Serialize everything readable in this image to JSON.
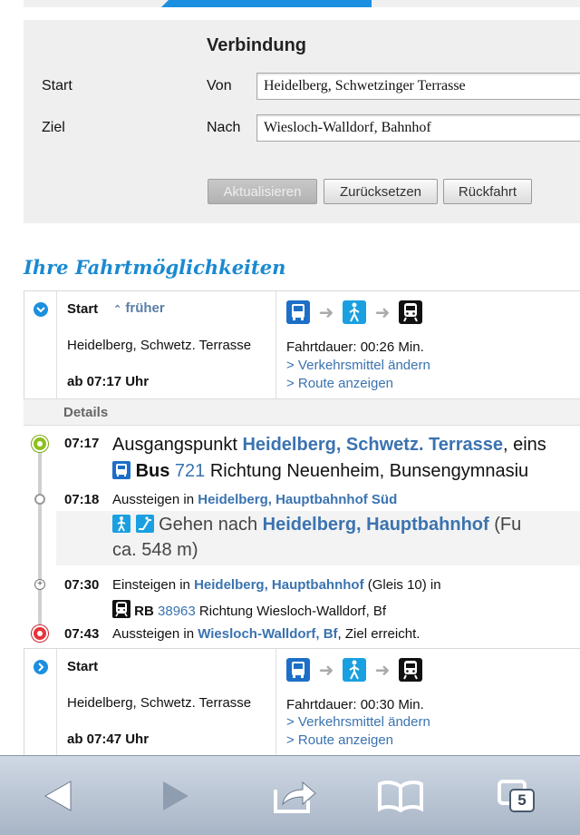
{
  "form": {
    "title": "Verbindung",
    "start_label": "Start",
    "ziel_label": "Ziel",
    "von_label": "Von",
    "nach_label": "Nach",
    "von_value": "Heidelberg, Schwetzinger Terrasse",
    "nach_value": "Wiesloch-Walldorf, Bahnhof",
    "buttons": {
      "update": "Aktualisieren",
      "reset": "Zurücksetzen",
      "return": "Rückfahrt"
    }
  },
  "results_title": "Ihre Fahrtmöglichkeiten",
  "results": [
    {
      "start_label": "Start",
      "earlier": "früher",
      "from": "Heidelberg, Schwetz. Terrasse",
      "departure": "ab 07:17 Uhr",
      "duration": "Fahrtdauer: 00:26 Min.",
      "change_modes": "> Verkehrsmittel ändern",
      "show_route": "> Route anzeigen"
    },
    {
      "start_label": "Start",
      "from": "Heidelberg, Schwetz. Terrasse",
      "departure": "ab 07:47 Uhr",
      "duration": "Fahrtdauer: 00:30 Min.",
      "change_modes": "> Verkehrsmittel ändern",
      "show_route": "> Route anzeigen"
    }
  ],
  "details": {
    "header": "Details",
    "steps": {
      "s1_time": "07:17",
      "s1_text": "Ausgangspunkt",
      "s1_place": "Heidelberg, Schwetz. Terrasse",
      "s1_tail": ", eins",
      "bus_word": "Bus",
      "bus_number": "721",
      "bus_direction": "Richtung Neuenheim, Bunsengymnasiu",
      "s2_time": "07:18",
      "s2_text": "Aussteigen in",
      "s2_place": "Heidelberg, Hauptbahnhof Süd",
      "walk_text": "Gehen nach",
      "walk_place": "Heidelberg, Hauptbahnhof",
      "walk_tail": "(Fu",
      "walk_distance": "ca. 548 m)",
      "s3_time": "07:30",
      "s3_text": "Einsteigen in",
      "s3_place": "Heidelberg, Hauptbahnhof",
      "s3_tail": "(Gleis 10) in",
      "train_word": "RB",
      "train_number": "38963",
      "train_direction": "Richtung Wiesloch-Walldorf, Bf",
      "s4_time": "07:43",
      "s4_text": "Aussteigen in",
      "s4_place": "Wiesloch-Walldorf, Bf",
      "s4_tail": ", Ziel erreicht."
    }
  },
  "toolbar": {
    "tabs_count": "5"
  },
  "colors": {
    "accent": "#1b8fe0",
    "link": "#3a73b0",
    "start_node": "#8ec01c",
    "end_node": "#e8333c"
  }
}
